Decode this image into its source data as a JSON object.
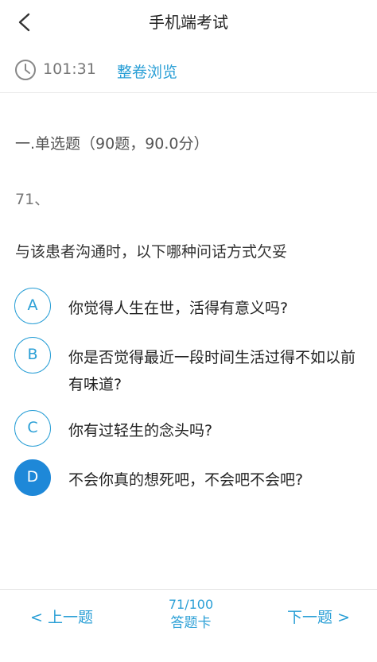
{
  "header": {
    "title": "手机端考试",
    "back_icon": "chevron-left-icon"
  },
  "info": {
    "timer": "101:31",
    "browse_label": "整卷浏览",
    "clock_icon": "clock-icon"
  },
  "section": {
    "title": "一.单选题（90题，90.0分）"
  },
  "question": {
    "number": "71、",
    "text": "与该患者沟通时，以下哪种问话方式欠妥",
    "options": [
      {
        "letter": "A",
        "text": "你觉得人生在世，活得有意义吗?",
        "selected": false
      },
      {
        "letter": "B",
        "text": "你是否觉得最近一段时间生活过得不如以前有味道?",
        "selected": false
      },
      {
        "letter": "C",
        "text": "你有过轻生的念头吗?",
        "selected": false
      },
      {
        "letter": "D",
        "text": "不会你真的想死吧，不会吧不会吧?",
        "selected": true
      }
    ]
  },
  "bottom": {
    "prev_label": "< 上一题",
    "progress": "71/100",
    "answer_card_label": "答题卡",
    "next_label": "下一题 >"
  },
  "colors": {
    "accent": "#2a9fd6",
    "selected_fill": "#1e88d8"
  }
}
